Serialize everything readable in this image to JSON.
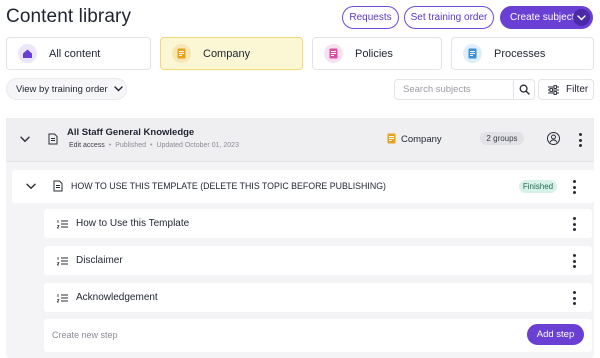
{
  "page": {
    "title": "Content library"
  },
  "header": {
    "requests_label": "Requests",
    "training_order_label": "Set training order",
    "create_subject_label": "Create subject"
  },
  "categories": [
    {
      "label": "All content",
      "icon": "home-icon",
      "color": "#6a3fd4"
    },
    {
      "label": "Company",
      "icon": "company-doc-icon",
      "color": "#e6a21b",
      "active": true
    },
    {
      "label": "Policies",
      "icon": "policies-doc-icon",
      "color": "#d94fa6"
    },
    {
      "label": "Processes",
      "icon": "processes-doc-icon",
      "color": "#3b8fd6"
    }
  ],
  "toolbar": {
    "view_label": "View by training order",
    "search_placeholder": "Search subjects",
    "filter_label": "Filter"
  },
  "subject": {
    "title": "All Staff General Knowledge",
    "access": "Edit access",
    "status": "Published",
    "updated": "Updated October 01, 2023",
    "category": "Company",
    "groups_badge": "2 groups"
  },
  "topic": {
    "title": "HOW TO USE THIS TEMPLATE (DELETE THIS TOPIC BEFORE PUBLISHING)",
    "status_badge": "Finished"
  },
  "steps": [
    {
      "label": "How to Use this Template"
    },
    {
      "label": "Disclaimer"
    },
    {
      "label": "Acknowledgement"
    }
  ],
  "new_step": {
    "placeholder": "Create new step",
    "add_label": "Add step"
  },
  "colors": {
    "accent": "#6a3fd4",
    "active_category_bg": "#fbf6d3",
    "finished_badge_bg": "#d8f2ea"
  }
}
